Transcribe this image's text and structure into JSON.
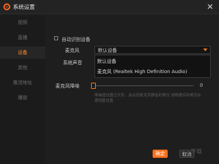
{
  "window": {
    "title": "系统设置"
  },
  "sidebar": {
    "items": [
      {
        "label": "视频",
        "active": false
      },
      {
        "label": "直播",
        "active": false
      },
      {
        "label": "设备",
        "active": true
      },
      {
        "label": "其他",
        "active": false
      },
      {
        "label": "推流地址",
        "active": false
      },
      {
        "label": "播放",
        "active": false
      }
    ]
  },
  "settings": {
    "auto_detect_label": "自动识别设备",
    "auto_detect_checked": false,
    "mic_label": "麦克风",
    "system_sound_label": "系统声音",
    "mic_select_value": "默认设备",
    "mic_options": [
      "默认设备",
      "麦克风 (Realtek High Definition Audio)"
    ],
    "noise_label": "麦克风降噪",
    "noise_value": "0",
    "noise_hint": "降噪值设置过大时，会出现麦克风静音的情况 请根据实际情况合理调整设置"
  },
  "buttons": {
    "ok": "确定",
    "cancel": "取消"
  },
  "watermark": "下载",
  "colors": {
    "accent": "#ff6f1a",
    "background": "#1e1e1e"
  }
}
